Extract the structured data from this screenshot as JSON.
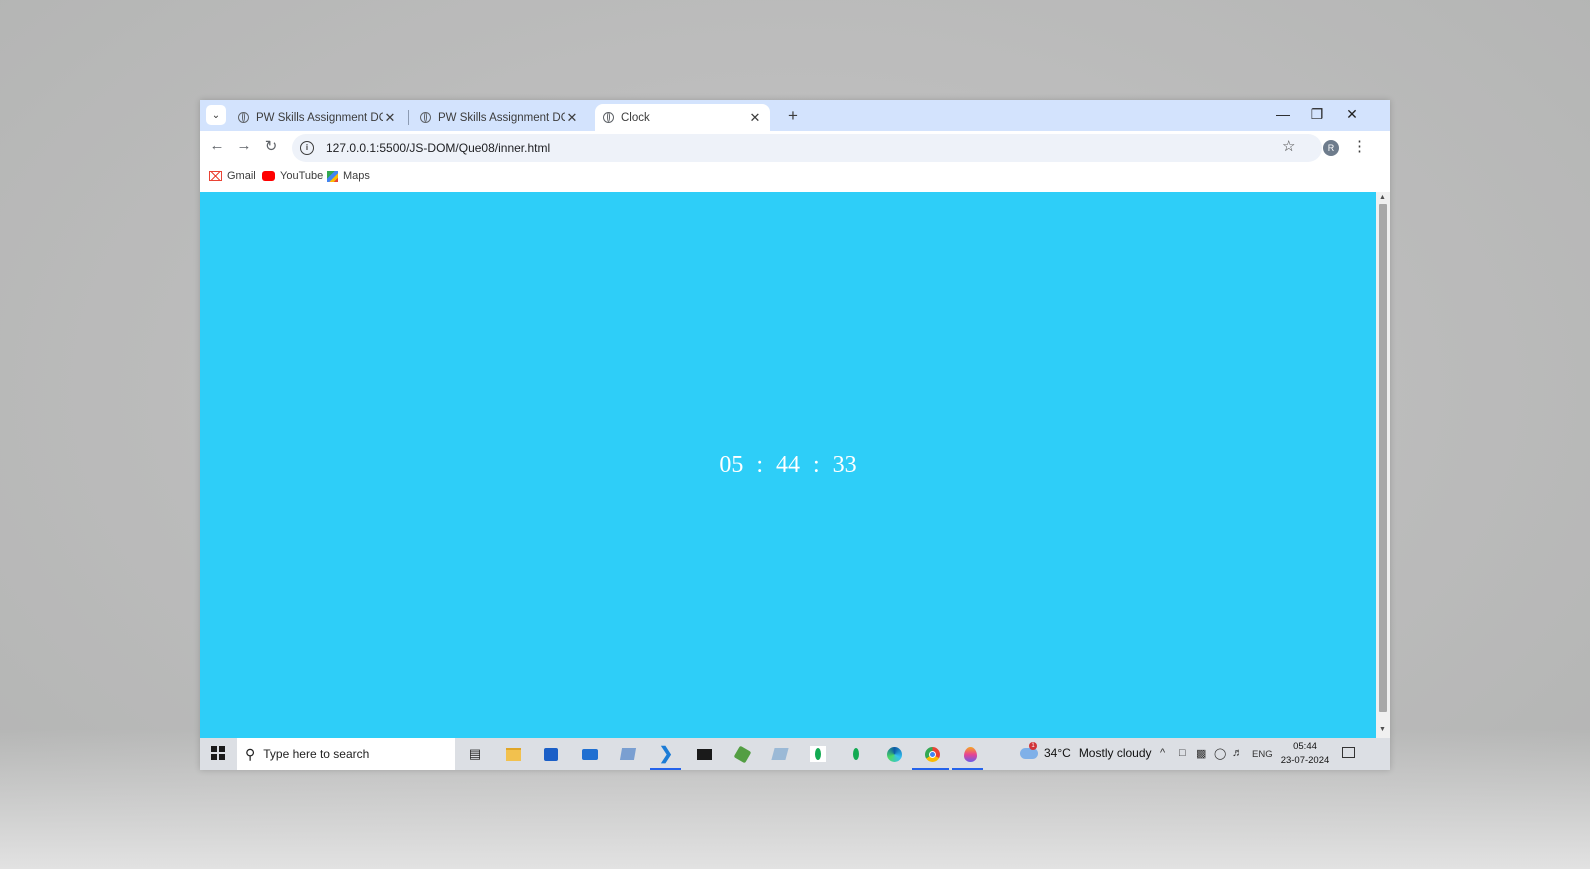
{
  "browser": {
    "tabs": [
      {
        "title": "PW Skills Assignment DOM-Ma",
        "active": false
      },
      {
        "title": "PW Skills Assignment DOM-Ma",
        "active": false
      },
      {
        "title": "Clock",
        "active": true
      }
    ],
    "url": "127.0.0.1:5500/JS-DOM/Que08/inner.html",
    "profile_initial": "R",
    "bookmarks": [
      "Gmail",
      "YouTube",
      "Maps"
    ]
  },
  "page": {
    "background": "#2ecef8",
    "clock": {
      "hours": "05",
      "minutes": "44",
      "seconds": "33",
      "separator": ":"
    }
  },
  "taskbar": {
    "search_placeholder": "Type here to search",
    "weather": {
      "temp": "34°C",
      "condition": "Mostly cloudy",
      "badge": "1"
    },
    "language": "ENG",
    "time": "05:44",
    "date": "23-07-2024"
  }
}
